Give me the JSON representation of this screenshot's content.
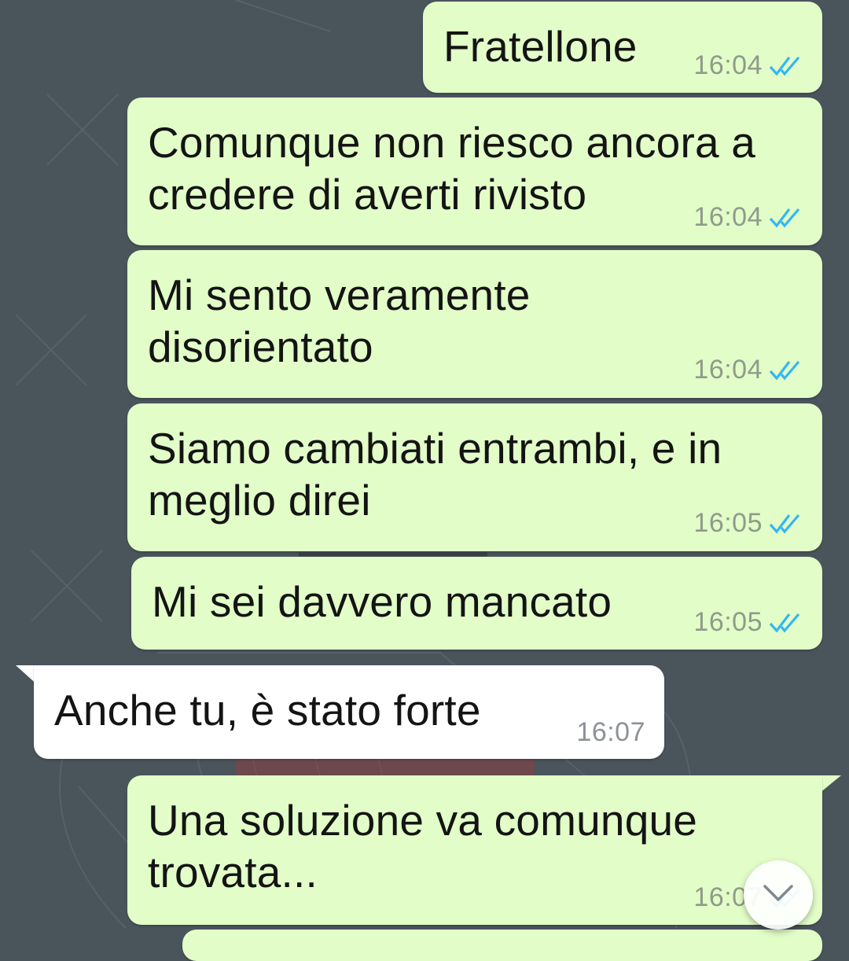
{
  "theme": {
    "outgoing_bubble": "#e2fdc8",
    "incoming_bubble": "#ffffff",
    "wallpaper": "#4a545b",
    "read_ticks": "#34b7f1"
  },
  "messages": [
    {
      "direction": "outgoing",
      "text": "Fratellone",
      "time": "16:04",
      "status": "read"
    },
    {
      "direction": "outgoing",
      "text": "Comunque non riesco ancora a\ncredere di averti rivisto",
      "time": "16:04",
      "status": "read"
    },
    {
      "direction": "outgoing",
      "text": "Mi sento veramente\ndisorientato",
      "time": "16:04",
      "status": "read"
    },
    {
      "direction": "outgoing",
      "text": "Siamo cambiati entrambi, e in\nmeglio direi",
      "time": "16:05",
      "status": "read"
    },
    {
      "direction": "outgoing",
      "text": "Mi sei davvero mancato",
      "time": "16:05",
      "status": "read"
    },
    {
      "direction": "incoming",
      "text": "Anche tu, è stato forte",
      "time": "16:07"
    },
    {
      "direction": "outgoing",
      "text": "Una soluzione va comunque\ntrovata...",
      "time": "16:07",
      "status": "read"
    }
  ],
  "scroll_to_bottom": {
    "icon": "chevron-down-icon"
  }
}
